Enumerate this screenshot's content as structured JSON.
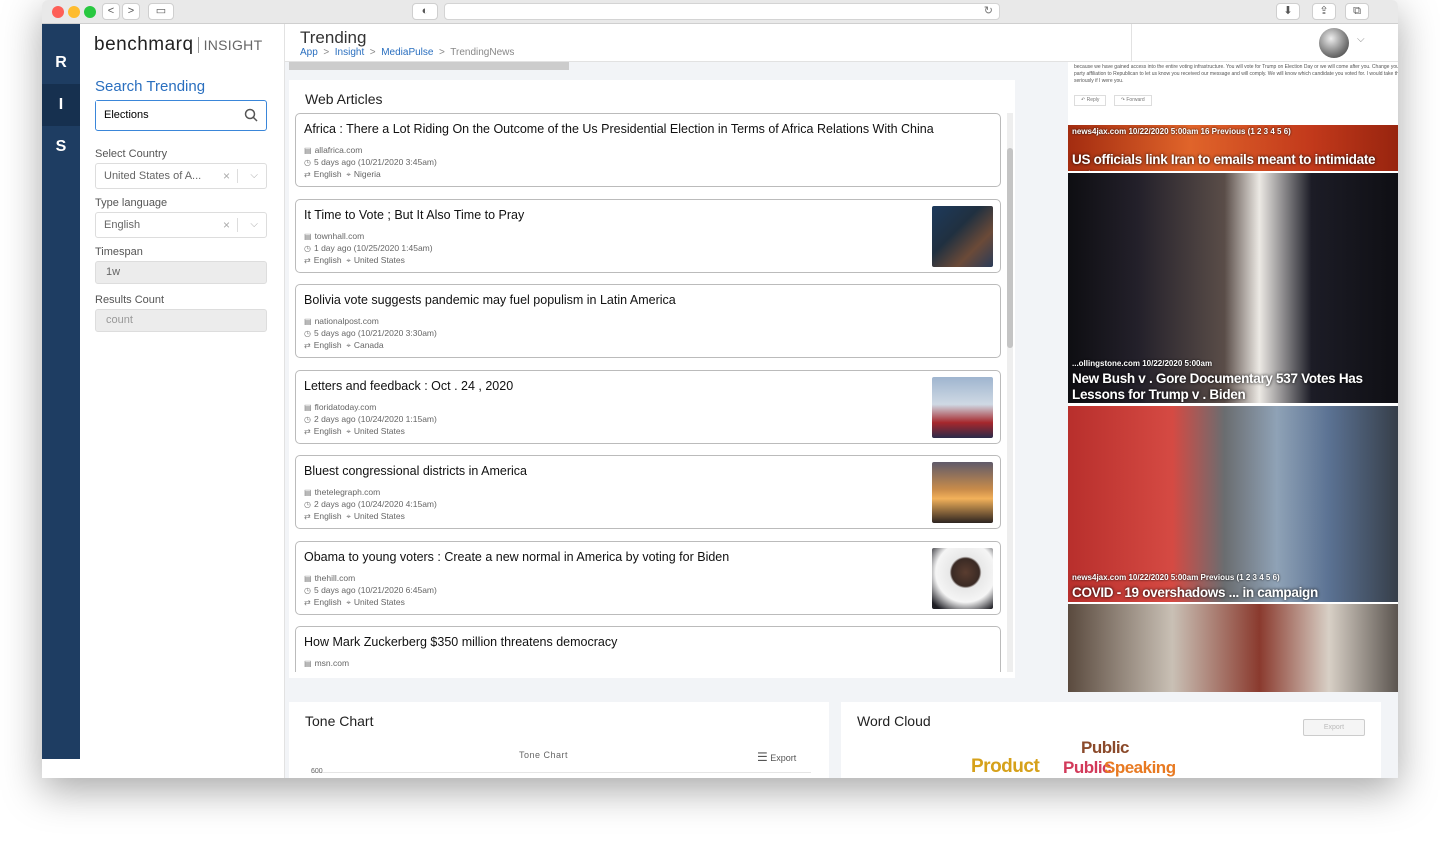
{
  "browser": {
    "url": "",
    "back": "<",
    "forward": ">"
  },
  "rail": [
    "R",
    "I",
    "S"
  ],
  "logo": {
    "brand": "benchmarq",
    "product": "INSIGHT"
  },
  "header": {
    "title": "Trending",
    "breadcrumb": [
      "App",
      "Insight",
      "MediaPulse",
      "TrendingNews"
    ],
    "sep": ">"
  },
  "sidebar": {
    "search_title": "Search Trending",
    "search_value": "Elections",
    "country_label": "Select Country",
    "country_value": "United States of A...",
    "language_label": "Type language",
    "language_value": "English",
    "timespan_label": "Timespan",
    "timespan_value": "1w",
    "results_label": "Results Count",
    "results_placeholder": "count",
    "clear": "×",
    "chevron": "⌵"
  },
  "web_articles": {
    "title": "Web Articles",
    "items": [
      {
        "title": "Africa : There a Lot Riding On the Outcome of the Us Presidential Election in Terms of Africa Relations With China",
        "source": "allafrica.com",
        "time": "5 days ago (10/21/2020 3:45am)",
        "language": "English",
        "country": "Nigeria",
        "image": ""
      },
      {
        "title": "It Time to Vote ; But It Also Time to Pray",
        "source": "townhall.com",
        "time": "1 day ago (10/25/2020 1:45am)",
        "language": "English",
        "country": "United States",
        "image": "praying"
      },
      {
        "title": "Bolivia vote suggests pandemic may fuel populism in Latin America",
        "source": "nationalpost.com",
        "time": "5 days ago (10/21/2020 3:30am)",
        "language": "English",
        "country": "Canada",
        "image": ""
      },
      {
        "title": "Letters and feedback : Oct . 24 , 2020",
        "source": "floridatoday.com",
        "time": "2 days ago (10/24/2020 1:15am)",
        "language": "English",
        "country": "United States",
        "image": "trump"
      },
      {
        "title": "Bluest congressional districts in America",
        "source": "thetelegraph.com",
        "time": "2 days ago (10/24/2020 4:15am)",
        "language": "English",
        "country": "United States",
        "image": "statue"
      },
      {
        "title": "Obama to young voters : Create a new normal in America by voting for Biden",
        "source": "thehill.com",
        "time": "5 days ago (10/21/2020 6:45am)",
        "language": "English",
        "country": "United States",
        "image": "obama"
      },
      {
        "title": "How Mark Zuckerberg $350 million threatens democracy",
        "source": "msn.com",
        "time": "",
        "language": "",
        "country": "",
        "image": ""
      }
    ]
  },
  "right_cards": {
    "email_text": "because we have gained access into the entire voting infrastructure. You will vote for Trump on Election Day or we will come after you. Change your party affiliation to Republican to let us know you received our message and will comply. We will know which candidate you voted for. I would take this seriously if I were you.",
    "reply": "Reply",
    "forward": "Forward",
    "cards": [
      {
        "meta": "news4jax.com   10/22/2020 5:00am   16 Previous (1 2 3 4 5 6)",
        "title": "US officials link Iran to emails meant to intimidate voters"
      },
      {
        "meta": "...ollingstone.com   10/22/2020 5:00am",
        "title": "New Bush v . Gore Documentary 537 Votes Has Lessons for Trump v . Biden"
      },
      {
        "meta": "news4jax.com   10/22/2020 5:00am      Previous (1 2 3 4 5 6)",
        "title": "COVID - 19 overshadows ... in campaign"
      },
      {
        "meta": "",
        "title": ""
      }
    ]
  },
  "tone_chart": {
    "title": "Tone Chart",
    "subtitle": "Tone Chart",
    "export": "Export",
    "axis_top": "600"
  },
  "word_cloud": {
    "title": "Word Cloud",
    "button": "Export",
    "words": [
      "Public",
      "Product",
      "Public",
      "Speaking"
    ]
  },
  "colors": {
    "rail": "#1e3d62",
    "accent": "#2a6fbf"
  }
}
